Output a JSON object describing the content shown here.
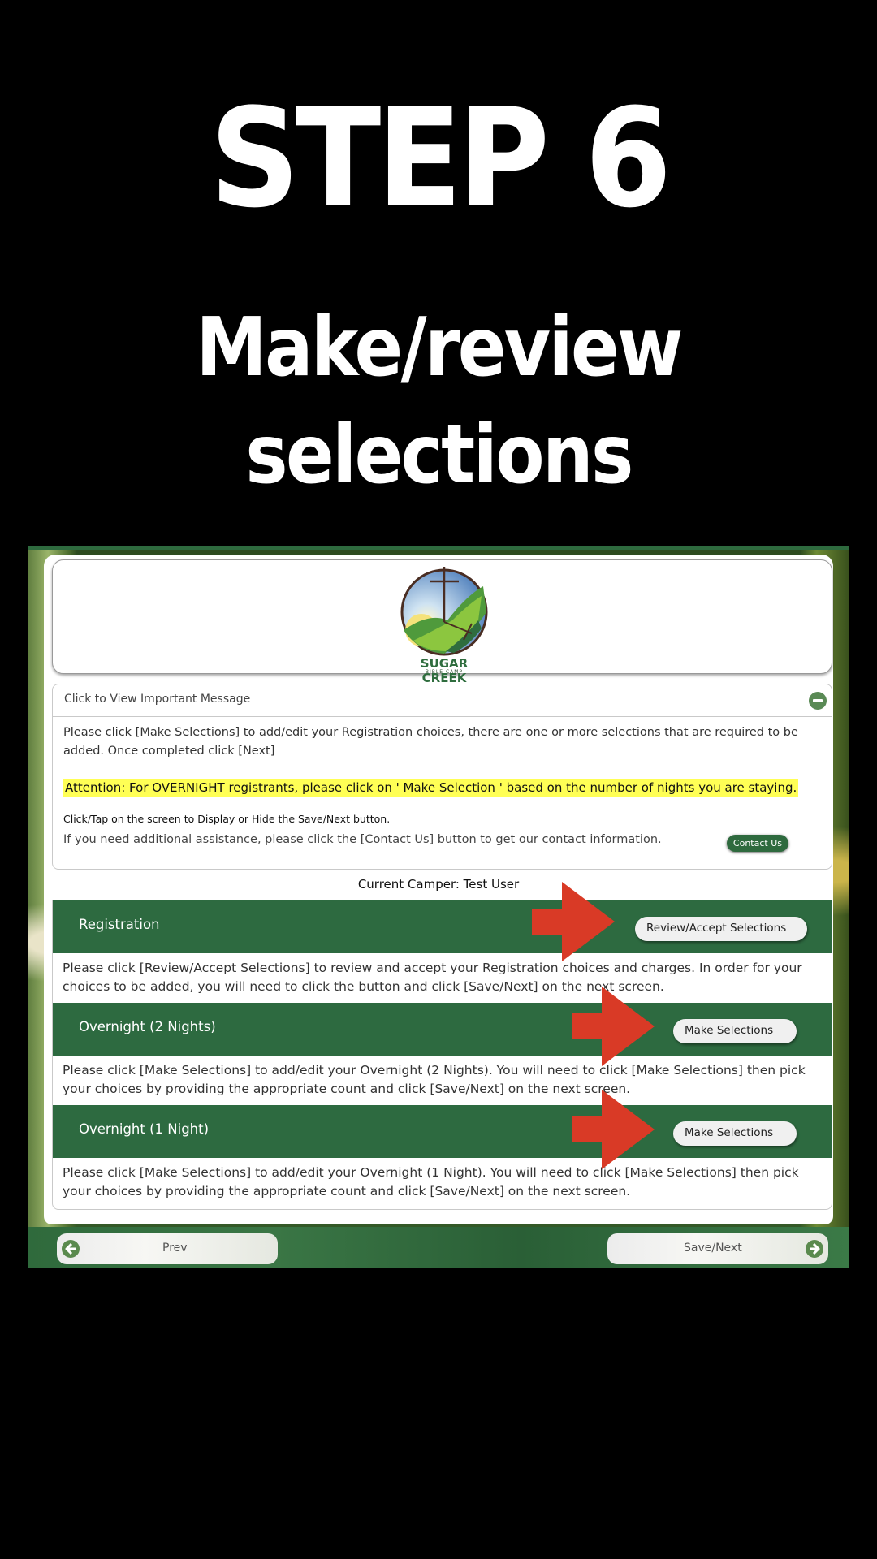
{
  "overlay": {
    "step": "STEP 6",
    "subtitle_line1": "Make/review",
    "subtitle_line2": "selections"
  },
  "logo": {
    "name": "SUGAR CREEK",
    "sub": "BIBLE CAMP"
  },
  "message": {
    "header": "Click to View Important Message",
    "collapse_icon": "minus-circle-icon",
    "paragraph": "Please click [Make Selections] to add/edit your Registration choices, there are one or more selections that are required to be added. Once completed click [Next]",
    "attention": "Attention: For OVERNIGHT registrants, please click on ' Make Selection ' based on the number of nights you are staying.",
    "tap_note": "Click/Tap on the screen to Display or Hide the Save/Next button.",
    "assistance": "If you need additional assistance, please click the [Contact Us] button to get our contact information.",
    "contact_button": "Contact Us"
  },
  "current_camper": "Current Camper: Test User",
  "sections": [
    {
      "title": "Registration",
      "button": "Review/Accept Selections",
      "description": "Please click [Review/Accept Selections] to review and accept your Registration choices and charges. In order for your choices to be added, you will need to click the button and click [Save/Next] on the next screen."
    },
    {
      "title": "Overnight (2 Nights)",
      "button": "Make Selections",
      "description": "Please click [Make Selections] to add/edit your Overnight (2 Nights). You will need to click [Make Selections] then pick your choices by providing the appropriate count and click [Save/Next] on the next screen."
    },
    {
      "title": "Overnight (1 Night)",
      "button": "Make Selections",
      "description": "Please click [Make Selections] to add/edit your Overnight (1 Night). You will need to click [Make Selections] then pick your choices by providing the appropriate count and click [Save/Next] on the next screen."
    }
  ],
  "footer": {
    "prev": "Prev",
    "next": "Save/Next"
  },
  "colors": {
    "brand_green": "#2d6a40",
    "highlight_yellow": "#ffff55",
    "annotation_red": "#d93a26"
  }
}
